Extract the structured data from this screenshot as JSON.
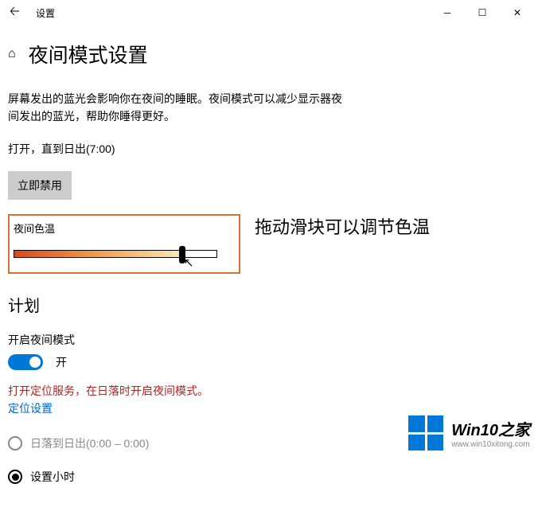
{
  "titlebar": {
    "app_name": "设置"
  },
  "header": {
    "page_title": "夜间模式设置"
  },
  "description": "屏幕发出的蓝光会影响你在夜间的睡眠。夜间模式可以减少显示器夜间发出的蓝光，帮助你睡得更好。",
  "schedule_status": "打开，直到日出(7:00)",
  "buttons": {
    "disable_now": "立即禁用"
  },
  "color_temp": {
    "label": "夜间色温",
    "value_percent": 83
  },
  "annotation": "拖动滑块可以调节色温",
  "plan": {
    "section_title": "计划",
    "enable_label": "开启夜间模式",
    "toggle_state": "开",
    "toggle_on": true,
    "warning": "打开定位服务，在日落时开启夜间模式。",
    "location_link": "定位设置",
    "radio_sunset": "日落到日出(0:00 – 0:00)",
    "radio_hours": "设置小时",
    "selected_option": "hours"
  },
  "watermark": {
    "main": "Win10之家",
    "sub": "www.win10xitong.com"
  }
}
